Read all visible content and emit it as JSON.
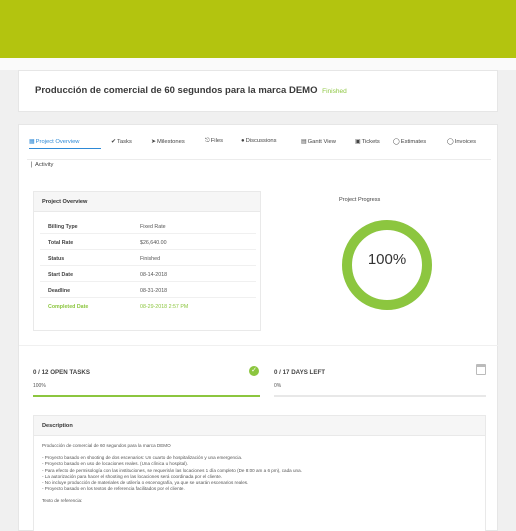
{
  "project": {
    "title": "Producción de comercial de 60 segundos para la marca DEMO",
    "status": "Finished"
  },
  "tabs": [
    {
      "label": "Project Overview",
      "icon": "overview-icon"
    },
    {
      "label": "Tasks",
      "icon": "tasks-icon"
    },
    {
      "label": "Milestones",
      "icon": "milestones-icon"
    },
    {
      "label": "Files",
      "icon": "files-icon"
    },
    {
      "label": "Discussions",
      "icon": "discussions-icon"
    },
    {
      "label": "Gantt View",
      "icon": "gantt-icon"
    },
    {
      "label": "Tickets",
      "icon": "tickets-icon"
    },
    {
      "label": "Estimates",
      "icon": "estimates-icon"
    },
    {
      "label": "Invoices",
      "icon": "invoices-icon"
    },
    {
      "label": "Activity",
      "icon": "activity-icon"
    }
  ],
  "overview": {
    "heading": "Project Overview",
    "rows": [
      {
        "key": "Billing Type",
        "value": "Fixed Rate"
      },
      {
        "key": "Total Rate",
        "value": "$26,640.00"
      },
      {
        "key": "Status",
        "value": "Finished"
      },
      {
        "key": "Start Date",
        "value": "08-14-2018"
      },
      {
        "key": "Deadline",
        "value": "08-31-2018"
      },
      {
        "key": "Completed Date",
        "value": "08-29-2018 2:57 PM"
      }
    ]
  },
  "progress": {
    "title": "Project Progress",
    "value": 100,
    "label": "100%",
    "color": "#8cc63f"
  },
  "tasks_stat": {
    "label": "0 / 12 OPEN TASKS",
    "percent_label": "100%",
    "fill": 1.0
  },
  "days_stat": {
    "label": "0 / 17 DAYS LEFT",
    "percent_label": "0%",
    "fill": 0.0
  },
  "description": {
    "heading": "Description",
    "intro": "Producción de comercial de 60 segundos para la marca DEMO",
    "bullets": [
      "- Proyecto basado en shooting de dos escenarios: Un cuarto de hospitalización y una emergencia.",
      "- Proyecto basado en uso de locaciones reales. (Una clínica u hospital).",
      "- Para efecto de permisología con las instituciones, se requerirán las locaciones 1 día completo (De 8:00 am a 6 pm), cada una.",
      "- La autorización para hacer el shooting en las locaciones será coordinada por el cliente.",
      "- No incluye producción de materiales de utilería o escenografía, ya que se usarán escenarios reales.",
      "- Proyecto basado en los textos de referencia facilitados por el cliente."
    ],
    "footer": "Texto de referencia:"
  }
}
